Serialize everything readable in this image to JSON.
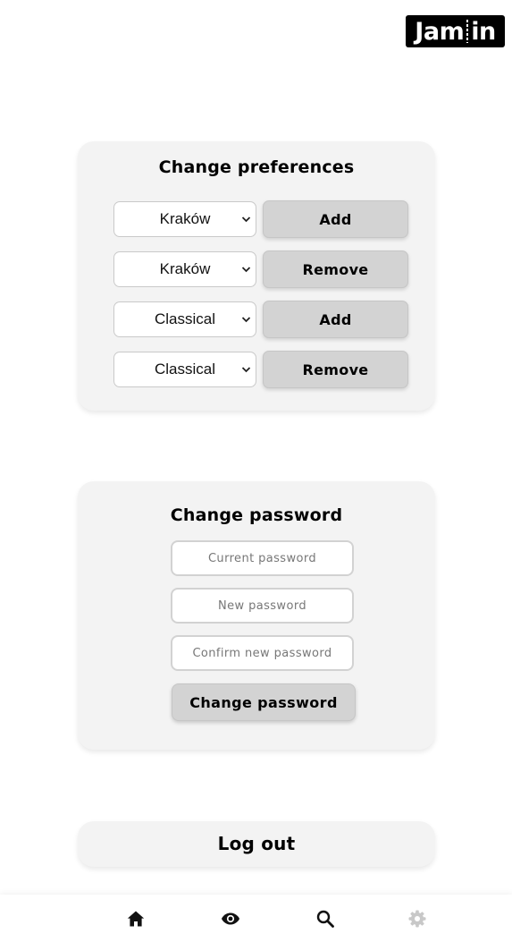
{
  "header": {
    "logo_left": "Jam",
    "logo_right": "in"
  },
  "preferences": {
    "title": "Change preferences",
    "rows": [
      {
        "value": "Kraków",
        "action": "Add"
      },
      {
        "value": "Kraków",
        "action": "Remove"
      },
      {
        "value": "Classical",
        "action": "Add"
      },
      {
        "value": "Classical",
        "action": "Remove"
      }
    ]
  },
  "password": {
    "title": "Change password",
    "current_placeholder": "Current password",
    "new_placeholder": "New password",
    "confirm_placeholder": "Confirm new password",
    "submit_label": "Change password"
  },
  "logout": {
    "label": "Log out"
  },
  "nav": {
    "items": [
      {
        "icon": "home-icon",
        "active": true
      },
      {
        "icon": "eye-icon",
        "active": true
      },
      {
        "icon": "search-icon",
        "active": true
      },
      {
        "icon": "gear-icon",
        "active": false
      }
    ],
    "active_color": "#111111",
    "inactive_color": "#c8c8c8"
  }
}
